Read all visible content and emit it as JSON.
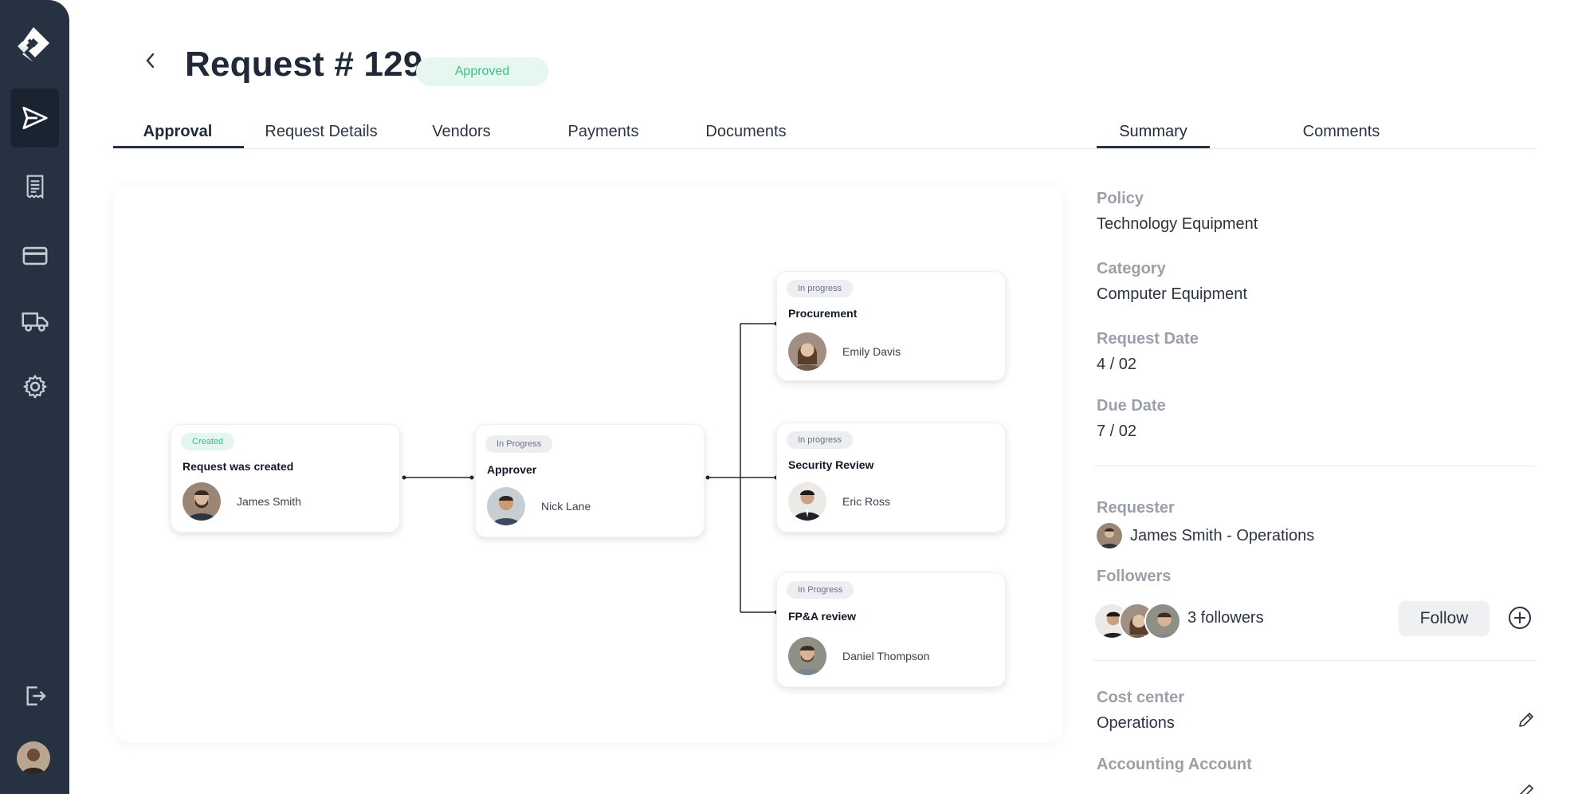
{
  "header": {
    "title": "Request # 129",
    "status_badge": "Approved"
  },
  "tabs": [
    {
      "label": "Approval",
      "active": true
    },
    {
      "label": "Request Details",
      "active": false
    },
    {
      "label": "Vendors",
      "active": false
    },
    {
      "label": "Payments",
      "active": false
    },
    {
      "label": "Documents",
      "active": false
    }
  ],
  "side_tabs": [
    {
      "label": "Summary",
      "active": true
    },
    {
      "label": "Comments",
      "active": false
    }
  ],
  "sidebar": {
    "items": [
      {
        "icon": "send-icon",
        "active": true
      },
      {
        "icon": "receipt-icon",
        "active": false
      },
      {
        "icon": "card-icon",
        "active": false
      },
      {
        "icon": "truck-icon",
        "active": false
      },
      {
        "icon": "gear-icon",
        "active": false
      }
    ],
    "bottom": [
      {
        "icon": "logout-icon"
      },
      {
        "icon": "user-avatar"
      }
    ]
  },
  "flow": {
    "cards": [
      {
        "status": "Created",
        "title": "Request was created",
        "person": "James Smith"
      },
      {
        "status": "In Progress",
        "title": "Approver",
        "person": "Nick Lane"
      },
      {
        "status": "In progress",
        "title": "Procurement",
        "person": "Emily Davis"
      },
      {
        "status": "In progress",
        "title": "Security Review",
        "person": "Eric Ross"
      },
      {
        "status": "In Progress",
        "title": "FP&A review",
        "person": "Daniel Thompson"
      }
    ]
  },
  "summary": {
    "policy_label": "Policy",
    "policy_value": "Technology Equipment",
    "category_label": "Category",
    "category_value": "Computer Equipment",
    "request_date_label": "Request Date",
    "request_date_value": "4 / 02",
    "due_date_label": "Due Date",
    "due_date_value": "7 / 02",
    "requester_label": "Requester",
    "requester_value": "James Smith - Operations",
    "followers_label": "Followers",
    "followers_value": "3 followers",
    "follow_button": "Follow",
    "cost_center_label": "Cost center",
    "cost_center_value": "Operations",
    "accounting_label": "Accounting Account"
  },
  "colors": {
    "sidebar": "#263241",
    "approved_bg": "#e5f7ef",
    "approved_text": "#3dbd8a"
  }
}
